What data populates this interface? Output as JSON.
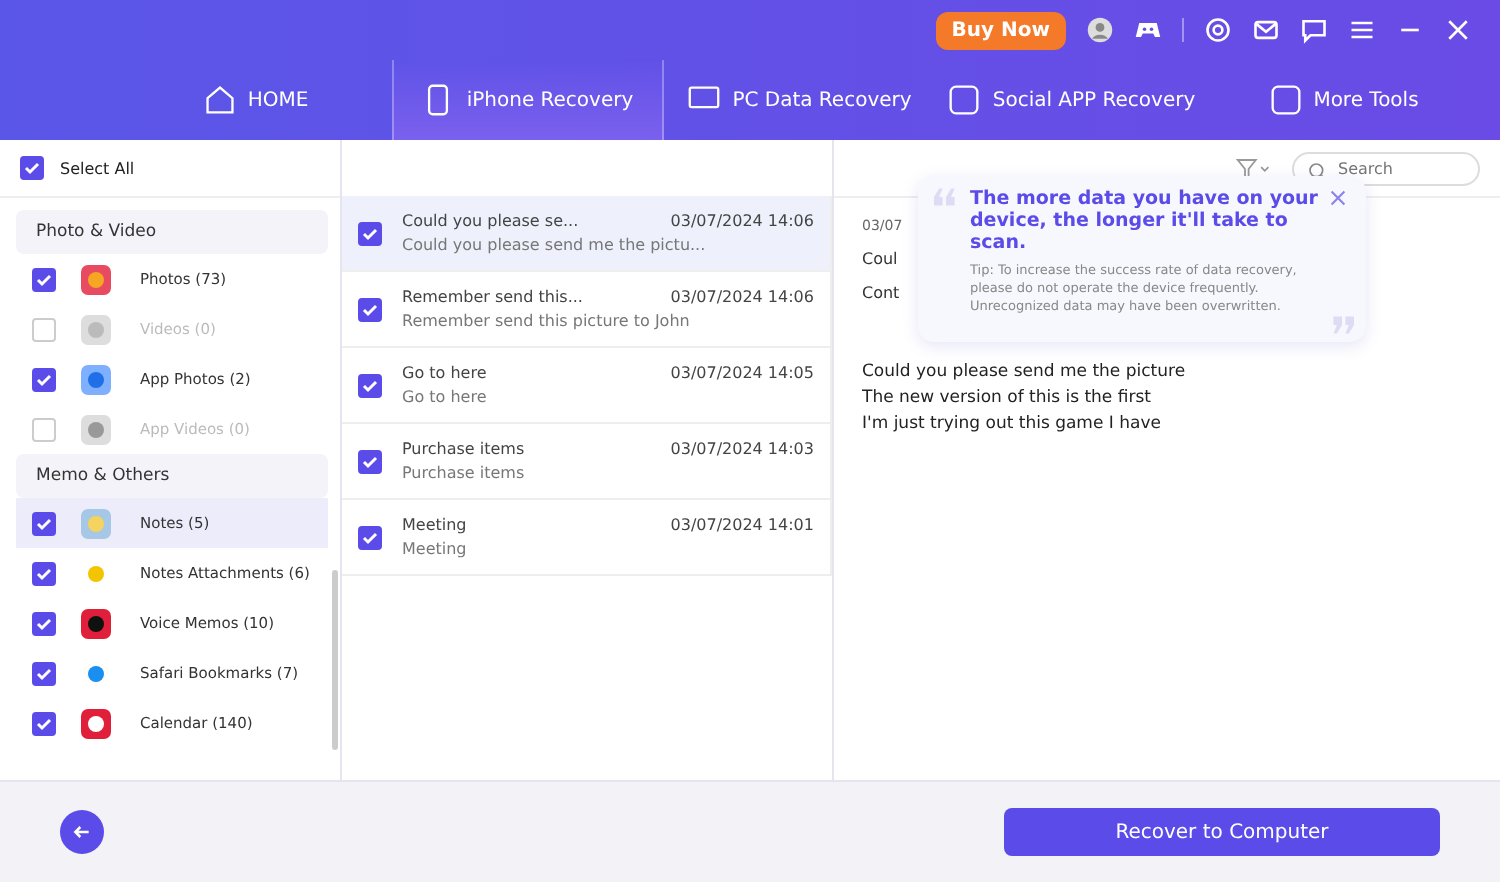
{
  "top_bar": {
    "buy_button": "Buy Now"
  },
  "nav_tabs": [
    {
      "label": "HOME",
      "selected": false
    },
    {
      "label": "iPhone Recovery",
      "selected": true
    },
    {
      "label": "PC Data Recovery",
      "selected": false
    },
    {
      "label": "Social APP Recovery",
      "selected": false
    },
    {
      "label": "More Tools",
      "selected": false
    }
  ],
  "sidebar": {
    "select_all": {
      "label": "Select All",
      "checked": true
    },
    "groups": [
      {
        "title": "Photo & Video",
        "items": [
          {
            "label": "Photos (73)",
            "checked": true,
            "disabled": false,
            "selected": false
          },
          {
            "label": "Videos (0)",
            "checked": false,
            "disabled": true,
            "selected": false
          },
          {
            "label": "App Photos (2)",
            "checked": true,
            "disabled": false,
            "selected": false
          },
          {
            "label": "App Videos (0)",
            "checked": false,
            "disabled": true,
            "selected": false
          }
        ]
      },
      {
        "title": "Memo & Others",
        "items": [
          {
            "label": "Notes (5)",
            "checked": true,
            "disabled": false,
            "selected": true
          },
          {
            "label": "Notes Attachments (6)",
            "checked": true,
            "disabled": false,
            "selected": false
          },
          {
            "label": "Voice Memos (10)",
            "checked": true,
            "disabled": false,
            "selected": false
          },
          {
            "label": "Safari Bookmarks (7)",
            "checked": true,
            "disabled": false,
            "selected": false
          },
          {
            "label": "Calendar (140)",
            "checked": true,
            "disabled": false,
            "selected": false
          }
        ]
      }
    ]
  },
  "search": {
    "placeholder": "Search"
  },
  "notes": [
    {
      "title": "Could you please se...",
      "preview": "Could you please send me the pictu...",
      "date": "03/07/2024 14:06",
      "checked": true,
      "selected": true
    },
    {
      "title": "Remember send this...",
      "preview": "Remember send this picture to John",
      "date": "03/07/2024 14:06",
      "checked": true,
      "selected": false
    },
    {
      "title": "Go to here",
      "preview": "Go to here",
      "date": "03/07/2024 14:05",
      "checked": true,
      "selected": false
    },
    {
      "title": "Purchase items",
      "preview": "Purchase items",
      "date": "03/07/2024 14:03",
      "checked": true,
      "selected": false
    },
    {
      "title": "Meeting",
      "preview": "Meeting",
      "date": "03/07/2024 14:01",
      "checked": true,
      "selected": false
    }
  ],
  "detail": {
    "date": "03/07",
    "title": "Coul",
    "content_label": "Cont",
    "body": [
      "Could you please send me the picture",
      "The new version of this is the first",
      "I'm just trying out this game I have"
    ]
  },
  "tip": {
    "headline": "The more data you have on your device, the longer it'll take to scan.",
    "text": "Tip: To increase the success rate of data recovery, please do not operate the device frequently. Unrecognized data may have been overwritten."
  },
  "recover_button": "Recover to Computer"
}
